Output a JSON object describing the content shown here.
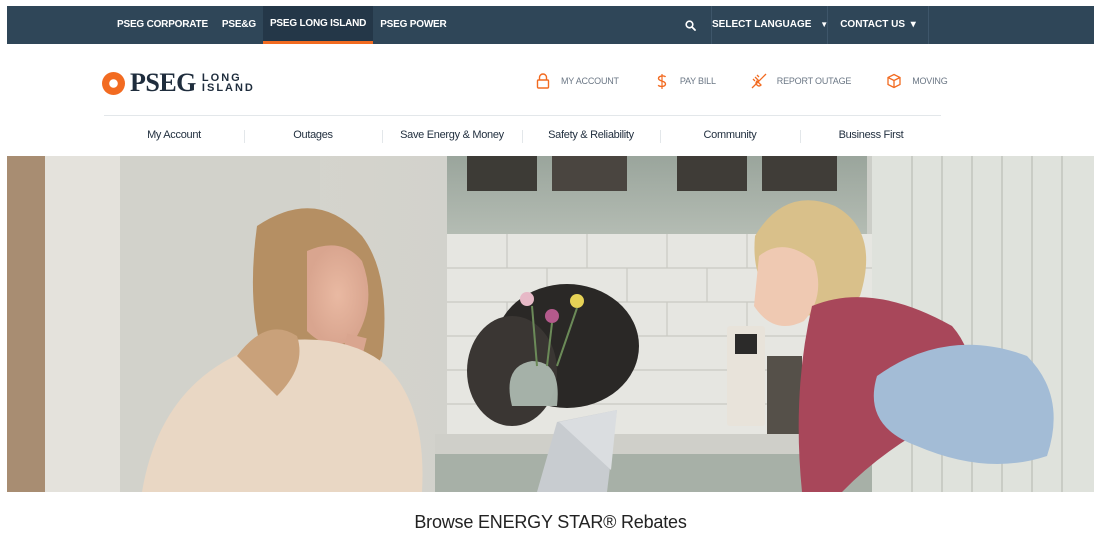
{
  "colors": {
    "topbar_bg": "#2f4658",
    "accent_orange": "#f26b21",
    "text_dark": "#1f2d3d",
    "text_muted": "#6b7785"
  },
  "topbar": {
    "site_links": [
      {
        "label": "PSEG CORPORATE",
        "active": false
      },
      {
        "label": "PSE&G",
        "active": false
      },
      {
        "label": "PSEG LONG ISLAND",
        "active": true
      },
      {
        "label": "PSEG POWER",
        "active": false
      }
    ],
    "search_icon": "search-icon",
    "language_label": "SELECT LANGUAGE",
    "language_caret": "▼",
    "contact_label": "CONTACT US",
    "contact_caret": "▾"
  },
  "logo": {
    "brand": "PSEG",
    "sub_line1": "LONG",
    "sub_line2": "ISLAND"
  },
  "quick_links": [
    {
      "label": "MY ACCOUNT",
      "icon": "lock-icon"
    },
    {
      "label": "PAY BILL",
      "icon": "dollar-icon"
    },
    {
      "label": "REPORT OUTAGE",
      "icon": "unplugged-icon"
    },
    {
      "label": "MOVING",
      "icon": "box-icon"
    }
  ],
  "main_nav": [
    {
      "label": "My Account"
    },
    {
      "label": "Outages"
    },
    {
      "label": "Save Energy & Money"
    },
    {
      "label": "Safety & Reliability"
    },
    {
      "label": "Community"
    },
    {
      "label": "Business First"
    }
  ],
  "hero": {
    "image": "hero-photo"
  },
  "page_heading": "Browse ENERGY STAR® Rebates"
}
